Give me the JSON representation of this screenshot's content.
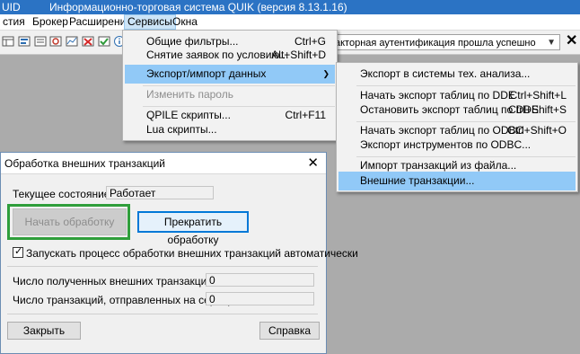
{
  "window": {
    "uid": "UID",
    "title": "Информационно-торговая система QUIK (версия 8.13.1.16)"
  },
  "menubar": {
    "items": [
      "стия",
      "Брокер",
      "Расширения",
      "Сервисы",
      "Окна"
    ]
  },
  "toolbar": {
    "combo_text": "акторная аутентификация прошла успешно",
    "close_glyph": "✕"
  },
  "services_menu": {
    "items": [
      {
        "label": "Общие фильтры...",
        "shortcut": "Ctrl+G"
      },
      {
        "label": "Снятие заявок по условию...",
        "shortcut": "Alt+Shift+D"
      },
      {
        "label": "Экспорт/импорт данных",
        "shortcut": ""
      },
      {
        "label": "Изменить пароль",
        "shortcut": ""
      },
      {
        "label": "QPILE скрипты...",
        "shortcut": "Ctrl+F11"
      },
      {
        "label": "Lua скрипты...",
        "shortcut": ""
      }
    ]
  },
  "export_submenu": {
    "items": [
      {
        "label": "Экспорт в системы тех. анализа...",
        "shortcut": ""
      },
      {
        "label": "Начать экспорт таблиц по DDE",
        "shortcut": "Ctrl+Shift+L"
      },
      {
        "label": "Остановить экспорт таблиц по DDE",
        "shortcut": "Ctrl+Shift+S"
      },
      {
        "label": "Начать экспорт таблиц по ODBC",
        "shortcut": "Ctrl+Shift+O"
      },
      {
        "label": "Экспорт инструментов по ODBC...",
        "shortcut": ""
      },
      {
        "label": "Импорт транзакций из файла...",
        "shortcut": ""
      },
      {
        "label": "Внешние транзакции...",
        "shortcut": ""
      }
    ]
  },
  "dialog": {
    "title": "Обработка внешних транзакций",
    "state_label": "Текущее состояние:",
    "state_value": "Работает",
    "start_button": "Начать обработку",
    "stop_button": "Прекратить обработку",
    "auto_start_label": "Запускать процесс обработки внешних транзакций автоматически",
    "received_label": "Число полученных внешних транзакций:",
    "received_value": "0",
    "sent_label": "Число транзакций, отправленных на сервер:",
    "sent_value": "0",
    "close_button": "Закрыть",
    "help_button": "Справка"
  }
}
